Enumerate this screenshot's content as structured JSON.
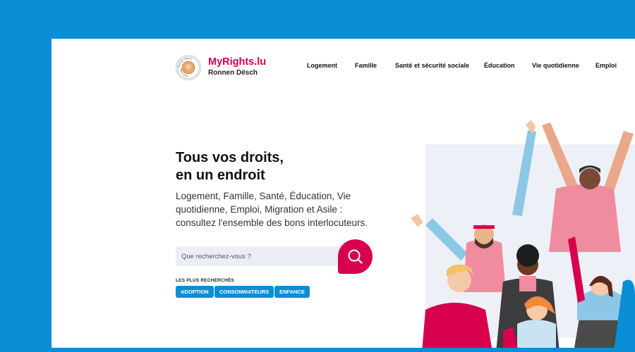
{
  "brand": {
    "name": "MyRights.lu",
    "subtitle": "Ronnen Dësch",
    "seal_text": "Ronnen Dësch · Table ronde"
  },
  "nav": {
    "items": [
      "Logement",
      "Famille",
      "Santé et sécurité sociale",
      "Éducation",
      "Vie quotidienne",
      "Emploi"
    ]
  },
  "hero": {
    "title_line1": "Tous vos droits,",
    "title_line2": "en un endroit",
    "description": "Logement, Famille, Santé, Éducation, Vie quotidienne, Emploi, Migration et Asile : consultez l'ensemble des bons interlocuteurs."
  },
  "search": {
    "placeholder": "Que recherchez-vous ?",
    "icon": "search-icon"
  },
  "popular": {
    "label": "LES PLUS RECHERCHÉS",
    "tags": [
      "ADOPTION",
      "CONSOMMATEURS",
      "ENFANCE"
    ]
  },
  "colors": {
    "frame": "#0a8ed6",
    "accent": "#d6004d",
    "tag": "#0a8ed6",
    "search_bg": "#eceef7"
  }
}
